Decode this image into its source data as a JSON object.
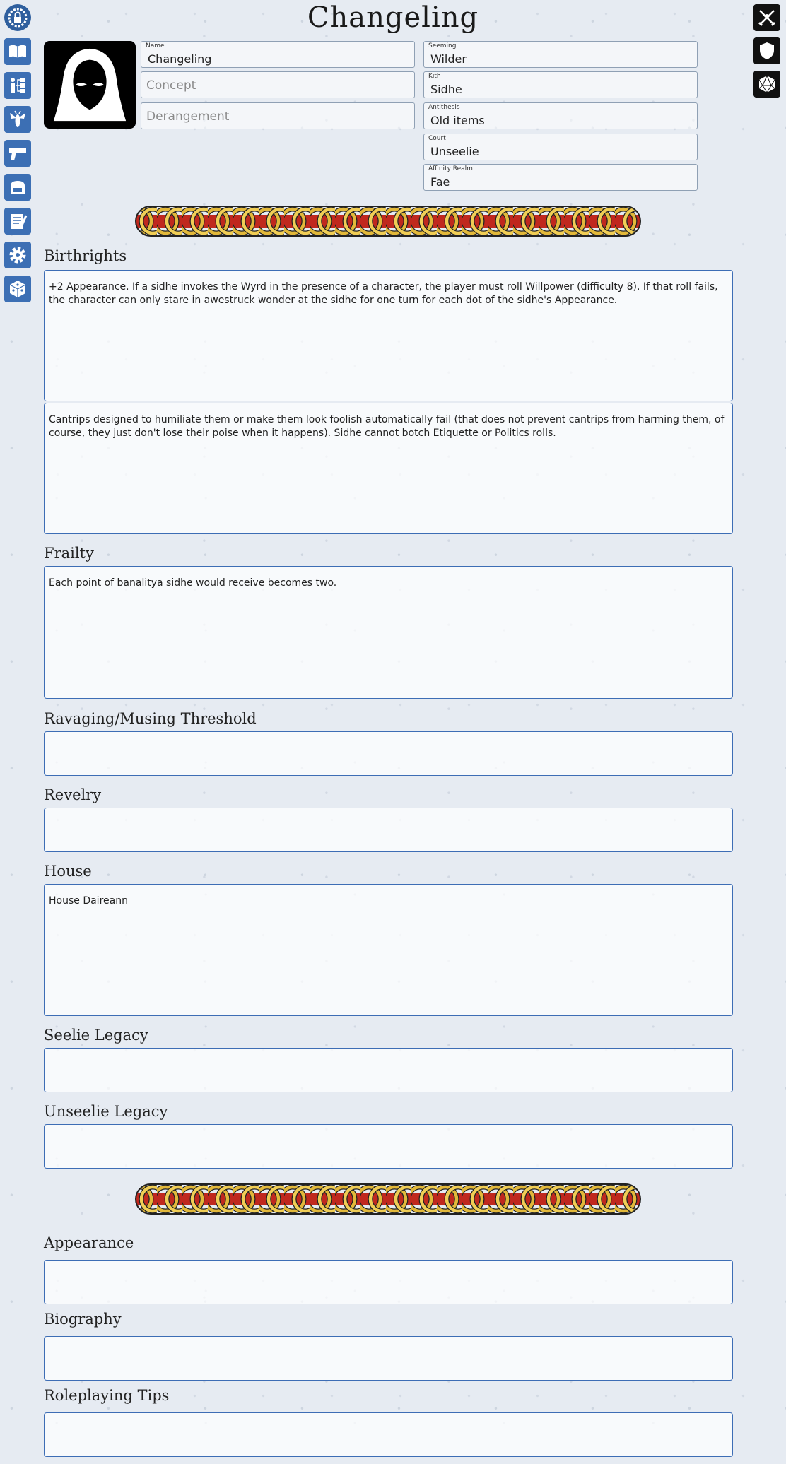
{
  "title": "Changeling",
  "left_nav": [
    {
      "icon": "lock-gear-icon"
    },
    {
      "icon": "book-icon"
    },
    {
      "icon": "flowchart-icon"
    },
    {
      "icon": "wasp-icon"
    },
    {
      "icon": "pistol-icon"
    },
    {
      "icon": "backpack-icon"
    },
    {
      "icon": "notepad-icon"
    },
    {
      "icon": "cog-icon"
    },
    {
      "icon": "dice-icon"
    }
  ],
  "right_nav": [
    {
      "icon": "crossed-swords-icon"
    },
    {
      "icon": "shield-icon"
    },
    {
      "icon": "d20-dice-icon"
    }
  ],
  "identity": {
    "name_label": "Name",
    "name": "Changeling",
    "concept_placeholder": "Concept",
    "derangement_placeholder": "Derangement",
    "seeming_label": "Seeming",
    "seeming": "Wilder",
    "kith_label": "Kith",
    "kith": "Sidhe",
    "antithesis_label": "Antithesis",
    "antithesis": "Old items",
    "court_label": "Court",
    "court": "Unseelie",
    "affinity_label": "Affinity Realm",
    "affinity": "Fae"
  },
  "sections": {
    "birthrights_title": "Birthrights",
    "birthright_1": "+2 Appearance. If a sidhe invokes the Wyrd in the presence of a character, the player must roll Willpower (difficulty 8). If that roll fails, the character can only stare in awestruck wonder at the sidhe for one turn for each dot of the sidhe's Appearance.",
    "birthright_2": "Cantrips designed to humiliate them or make them look foolish automatically fail (that does not prevent cantrips from harming them, of course, they just don't lose their poise when it happens). Sidhe cannot botch Etiquette or Politics rolls.",
    "frailty_title": "Frailty",
    "frailty": "Each point of banalitya sidhe would receive becomes two.",
    "threshold_title": "Ravaging/Musing Threshold",
    "threshold": "",
    "revelry_title": "Revelry",
    "revelry": "",
    "house_title": "House",
    "house": "House Daireann",
    "seelie_title": "Seelie Legacy",
    "seelie": "",
    "unseelie_title": "Unseelie Legacy",
    "unseelie": "",
    "appearance_title": "Appearance",
    "appearance": "",
    "biography_title": "Biography",
    "biography": "",
    "roleplaying_title": "Roleplaying Tips",
    "roleplaying": ""
  },
  "colors": {
    "accent": "#3d6db5",
    "knot_gold": "#e2b83a",
    "knot_red": "#c0281e"
  }
}
